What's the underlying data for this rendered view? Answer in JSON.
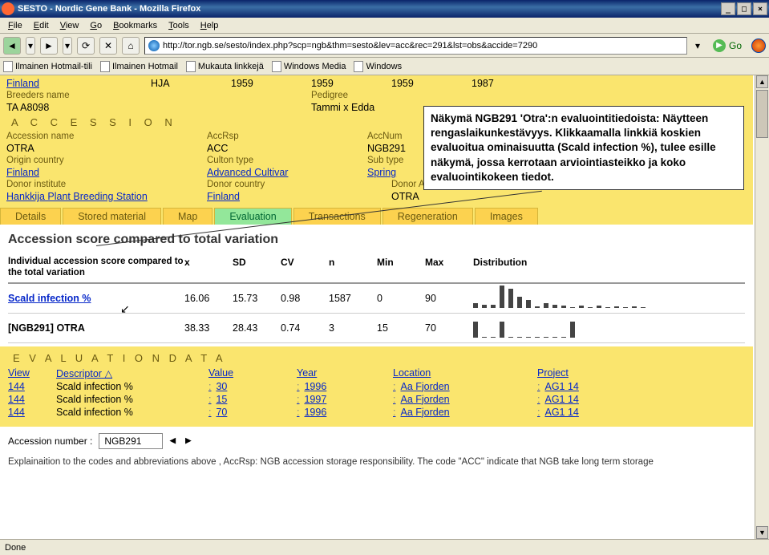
{
  "window": {
    "title": "SESTO - Nordic Gene Bank - Mozilla Firefox"
  },
  "menus": [
    "File",
    "Edit",
    "View",
    "Go",
    "Bookmarks",
    "Tools",
    "Help"
  ],
  "url": "http://tor.ngb.se/sesto/index.php?scp=ngb&thm=sesto&lev=acc&rec=291&lst=obs&accide=7290",
  "go_label": "Go",
  "bookmarks": [
    "Ilmainen Hotmail-tili",
    "Ilmainen Hotmail",
    "Mukauta linkkejä",
    "Windows Media",
    "Windows"
  ],
  "callout": "Näkymä NGB291 'Otra':n evaluointitiedoista: Näytteen rengaslaikunkestävyys. Klikkaamalla linkkiä koskien evaluoitua ominaisuutta (Scald infection %), tulee esille näkymä, jossa kerrotaan arviointiasteikko ja koko evaluointikokeen tiedot.",
  "top_row": {
    "country": "Finland",
    "code": "HJA",
    "y1": "1959",
    "y2": "1959",
    "y3": "1959",
    "y4": "1987"
  },
  "breeders": {
    "name_h": "Breeders name",
    "name": "TA A8098",
    "ped_h": "Pedigree",
    "ped": "Tammi x Edda"
  },
  "accession_h": "A C C E S S I O N",
  "acc": {
    "name_h": "Accession name",
    "name": "OTRA",
    "rsp_h": "AccRsp",
    "rsp": "ACC",
    "num_h": "AccNum",
    "num": "NGB291",
    "orig_h": "Origin country",
    "orig": "Finland",
    "culton_h": "Culton type",
    "culton": "Advanced Cultivar",
    "sub_h": "Sub type",
    "sub": "Spring",
    "donor_inst_h": "Donor institute",
    "donor_inst": "Hankkija Plant Breeding Station",
    "donor_country_h": "Donor country",
    "donor_country": "Finland",
    "donor_accnum_h": "Donor AccNum",
    "donor_accnum": "OTRA"
  },
  "tabs": [
    "Details",
    "Stored material",
    "Map",
    "Evaluation",
    "Transactions",
    "Regeneration",
    "Images"
  ],
  "active_tab": 3,
  "compare_title": "Accession score compared to total variation",
  "compare_headers": {
    "lbl": "Individual accession score compared to the total variation",
    "x": "x",
    "sd": "SD",
    "cv": "CV",
    "n": "n",
    "min": "Min",
    "max": "Max",
    "dist": "Distribution"
  },
  "compare_rows": [
    {
      "label": "Scald infection %",
      "link": true,
      "x": "16.06",
      "sd": "15.73",
      "cv": "0.98",
      "n": "1587",
      "min": "0",
      "max": "90",
      "dist": [
        6,
        4,
        4,
        28,
        24,
        14,
        10,
        2,
        6,
        4,
        3,
        1,
        3,
        1,
        3,
        1,
        2,
        1,
        2,
        1
      ]
    },
    {
      "label": "[NGB291] OTRA",
      "link": false,
      "x": "38.33",
      "sd": "28.43",
      "cv": "0.74",
      "n": "3",
      "min": "15",
      "max": "70",
      "dist": [
        20,
        0,
        0,
        20,
        0,
        0,
        0,
        0,
        0,
        0,
        0,
        20
      ]
    }
  ],
  "eval_h": "E V A L U A T I O N   D A T A",
  "eval_headers": {
    "view": "View",
    "desc": "Descriptor",
    "val": "Value",
    "year": "Year",
    "loc": "Location",
    "proj": "Project"
  },
  "eval_rows": [
    {
      "view": "144",
      "desc": "Scald infection %",
      "val": "30",
      "year": "1996",
      "loc": "Aa Fjorden",
      "proj": "AG1 14"
    },
    {
      "view": "144",
      "desc": "Scald infection %",
      "val": "15",
      "year": "1997",
      "loc": "Aa Fjorden",
      "proj": "AG1 14"
    },
    {
      "view": "144",
      "desc": "Scald infection %",
      "val": "70",
      "year": "1996",
      "loc": "Aa Fjorden",
      "proj": "AG1 14"
    }
  ],
  "accnum_label": "Accession number :",
  "accnum_value": "NGB291",
  "explain": "Explainaition to the codes and abbreviations above , AccRsp: NGB accession storage responsibility. The code \"ACC\" indicate that NGB take long term storage",
  "status": "Done"
}
